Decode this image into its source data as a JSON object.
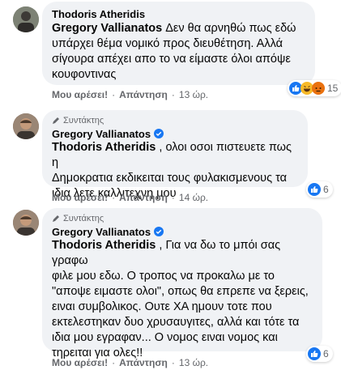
{
  "comments": [
    {
      "author": "Thodoris Atheridis",
      "tag": "Gregory Vallianatos",
      "text_lines": [
        " Δεν θα αρνηθώ πως εδώ",
        "υπάρχει θέμα νομικό προς διευθέτηση. Αλλά",
        "σίγουρα απέχει απο το να είμαστε όλοι απόψε",
        "κουφοντινας"
      ],
      "actions": {
        "like": "Μου αρέσει!",
        "reply": "Απάντηση",
        "time": "13 ώρ."
      },
      "reaction_count": "15",
      "reaction_icons": [
        "like-icon",
        "haha-icon",
        "angry-icon"
      ]
    },
    {
      "badge": "Συντάκτης",
      "author": "Gregory Vallianatos",
      "tag": "Thodoris Atheridis",
      "text_lines": [
        " , ολοι οσοι πιστευετε πως η",
        "Δημοκρατια εκδικειται τους φυλακισμενους τα",
        "ιδια λετε καλλιτεχνη μου"
      ],
      "actions": {
        "like": "Μου αρέσει!",
        "reply": "Απάντηση",
        "time": "14 ώρ."
      },
      "reaction_count": "6",
      "reaction_icons": [
        "like-icon"
      ]
    },
    {
      "badge": "Συντάκτης",
      "author": "Gregory Vallianatos",
      "tag": "Thodoris Atheridis",
      "text_lines": [
        " , Για να δω το μπόι σας γραφω",
        "φιλε μου εδω. Ο τροπος να προκαλω με το",
        "\"αποψε ειμαστε ολοι\", οπως θα επρεπε να ξερεις,",
        "ειναι συμβολικος. Ουτε ΧΑ ημουν τοτε που",
        "εκτελεστηκαν δυο χρυσαυγιτες, αλλά και τότε τα",
        "ιδια μου εγραφαν... Ο νομος ειναι νομος και",
        "τηρειται για ολες!!"
      ],
      "actions": {
        "like": "Μου αρέσει!",
        "reply": "Απάντηση",
        "time": "13 ώρ."
      },
      "reaction_count": "6",
      "reaction_icons": [
        "like-icon"
      ]
    }
  ],
  "colors": {
    "bubble": "#f0f2f5",
    "secondary_text": "#65676b",
    "like_blue": "#1877f2",
    "haha_yellow": "#f7b928",
    "angry_orange": "#e9710f"
  }
}
